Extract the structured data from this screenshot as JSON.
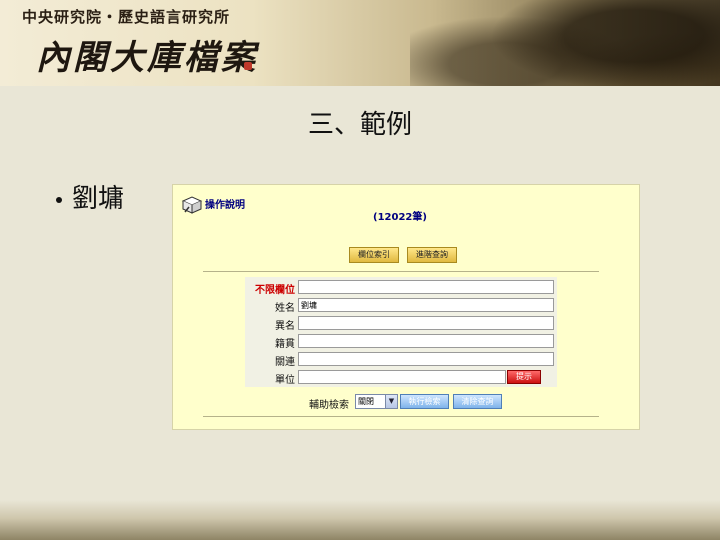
{
  "header": {
    "institute": "中央研究院・歷史語言研究所",
    "logo_text": "內閣大庫檔案"
  },
  "slide": {
    "title": "三、範例",
    "bullet": "劉墉"
  },
  "panel": {
    "operation_label": "操作說明",
    "record_count": "(12022筆)",
    "buttons": {
      "field_index": "欄位索引",
      "advanced_query": "進階查詢"
    },
    "fields": [
      {
        "label": "不限欄位",
        "value": "",
        "highlight": true
      },
      {
        "label": "姓名",
        "value": "劉墉",
        "highlight": false
      },
      {
        "label": "異名",
        "value": "",
        "highlight": false
      },
      {
        "label": "籍貫",
        "value": "",
        "highlight": false
      },
      {
        "label": "關連",
        "value": "",
        "highlight": false
      },
      {
        "label": "單位",
        "value": "",
        "highlight": false
      }
    ],
    "submit_label": "提示",
    "aux_search_label": "輔助檢索",
    "aux_search_selected": "關閉",
    "execute_label": "執行檢索",
    "clear_label": "清除查詢"
  },
  "colors": {
    "panel_bg": "#ffffcc",
    "accent_red": "#cc0000",
    "text_navy": "#000080"
  }
}
